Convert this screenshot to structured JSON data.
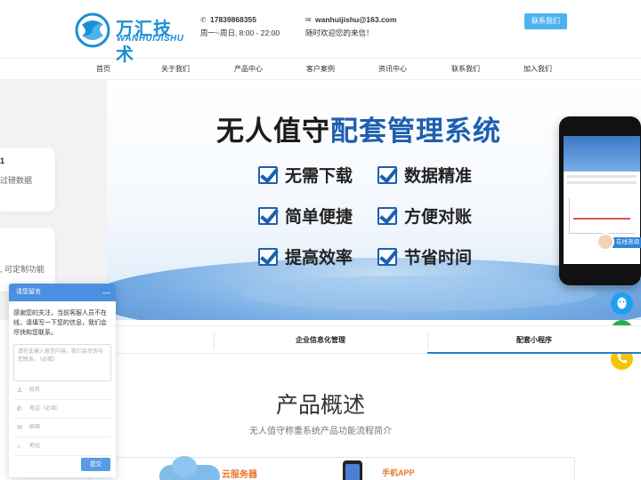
{
  "header": {
    "logo_cn": "万汇技术",
    "logo_en": "WANHUIJISHU",
    "phone": "17839868355",
    "hours": "周一~周日, 8:00 - 22:00",
    "email": "wanhuijishu@163.com",
    "email_note": "随时欢迎您的来信！",
    "contact_button": "联系我们"
  },
  "nav": {
    "items": [
      "首页",
      "关于我们",
      "产品中心",
      "客户案例",
      "资讯中心",
      "联系我们",
      "加入我们"
    ]
  },
  "hero": {
    "title_part1": "无人值守",
    "title_part2": "配套管理系统",
    "features": [
      "无需下载",
      "数据精准",
      "简单便捷",
      "方便对账",
      "提高效率",
      "节省时间"
    ]
  },
  "side_cards": {
    "card1_text_a": "1",
    "card1_text_b": "过磅数据",
    "card2_text": ", 可定制功能"
  },
  "tabs": {
    "items": [
      "企业信息化管理",
      "配套小程序"
    ],
    "active_index": 1
  },
  "overview": {
    "title": "产品概述",
    "subtitle": "无人值守称重系统产品功能流程简介",
    "flow_cloud_label": "云服务器",
    "flow_app_label": "手机APP"
  },
  "floating": {
    "online_label": "在线咨询",
    "icons": [
      "qq-icon",
      "wechat-icon",
      "phone-icon"
    ]
  },
  "chat": {
    "title": "请您留言",
    "minimize": "—",
    "message": "感谢您的关注，当前客服人员不在线，请填写一下您的信息，我们会尽快和您联系。",
    "textarea_placeholder": "请在此输入留言内容，我们会尽快与您联系。（必填）",
    "fields": [
      "姓名",
      "电话（必填）",
      "邮箱",
      "地址"
    ],
    "submit": "提交"
  }
}
